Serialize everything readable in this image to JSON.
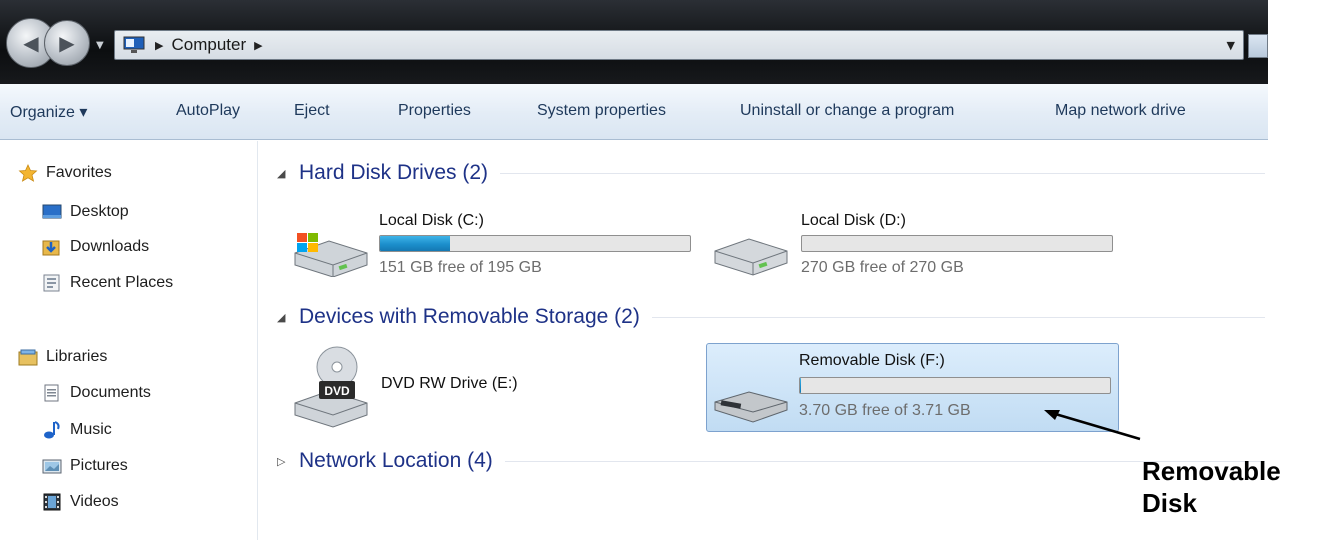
{
  "address_bar": {
    "path": "Computer"
  },
  "toolbar": {
    "organize": "Organize ▾",
    "autoplay": "AutoPlay",
    "eject": "Eject",
    "properties": "Properties",
    "system_properties": "System properties",
    "uninstall": "Uninstall or change a program",
    "map_network_drive": "Map network drive"
  },
  "sidebar": {
    "favorites": {
      "label": "Favorites",
      "items": [
        "Desktop",
        "Downloads",
        "Recent Places"
      ]
    },
    "libraries": {
      "label": "Libraries",
      "items": [
        "Documents",
        "Music",
        "Pictures",
        "Videos"
      ]
    }
  },
  "groups": {
    "hard_disk": {
      "title": "Hard Disk Drives (2)",
      "drives": [
        {
          "name": "Local Disk (C:)",
          "free_text": "151 GB free of 195 GB",
          "used_fraction": 0.226
        },
        {
          "name": "Local Disk (D:)",
          "free_text": "270 GB free of 270 GB",
          "used_fraction": 0.0
        }
      ]
    },
    "removable": {
      "title": "Devices with Removable Storage (2)",
      "drives": [
        {
          "name": "DVD RW Drive (E:)",
          "icon_label": "DVD"
        },
        {
          "name": "Removable Disk (F:)",
          "free_text": "3.70 GB free of 3.71 GB",
          "used_fraction": 0.003
        }
      ]
    },
    "network": {
      "title": "Network Location (4)"
    }
  },
  "annotation": {
    "line1": "Removable",
    "line2": "Disk"
  },
  "colors": {
    "accent_link": "#1e395b",
    "group_title": "#1e3287",
    "bar_fill": "#1c8fcc",
    "selection": "#c1dcf3"
  }
}
